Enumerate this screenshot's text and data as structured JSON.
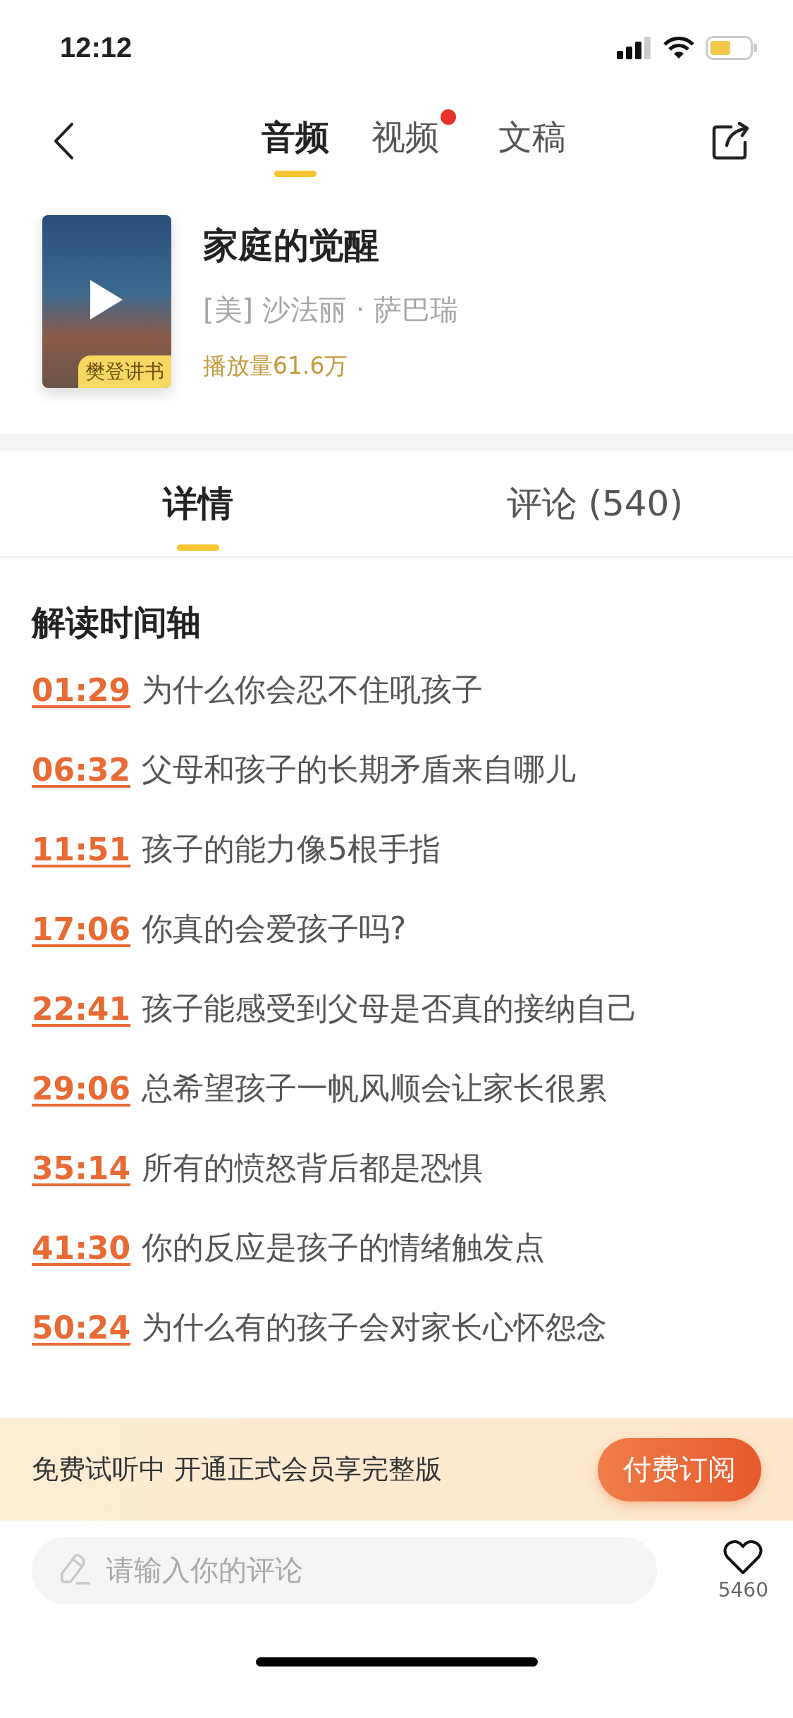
{
  "status_bar": {
    "time": "12:12"
  },
  "nav": {
    "tabs": [
      {
        "label": "音频",
        "selected": true,
        "dot": false
      },
      {
        "label": "视频",
        "selected": false,
        "dot": true
      },
      {
        "label": "文稿",
        "selected": false,
        "dot": false
      }
    ]
  },
  "book": {
    "badge": "樊登讲书",
    "title": "家庭的觉醒",
    "author": "[美] 沙法丽 · 萨巴瑞",
    "plays": "播放量61.6万"
  },
  "detail_tabs": [
    {
      "label": "详情",
      "selected": true
    },
    {
      "label": "评论 (540)",
      "selected": false
    }
  ],
  "timeline": {
    "title": "解读时间轴",
    "items": [
      {
        "time": "01:29",
        "title": "为什么你会忍不住吼孩子"
      },
      {
        "time": "06:32",
        "title": "父母和孩子的长期矛盾来自哪儿"
      },
      {
        "time": "11:51",
        "title": "孩子的能力像5根手指"
      },
      {
        "time": "17:06",
        "title": "你真的会爱孩子吗?"
      },
      {
        "time": "22:41",
        "title": "孩子能感受到父母是否真的接纳自己"
      },
      {
        "time": "29:06",
        "title": "总希望孩子一帆风顺会让家长很累"
      },
      {
        "time": "35:14",
        "title": "所有的愤怒背后都是恐惧"
      },
      {
        "time": "41:30",
        "title": "你的反应是孩子的情绪触发点"
      },
      {
        "time": "50:24",
        "title": "为什么有的孩子会对家长心怀怨念"
      }
    ]
  },
  "trial_banner": {
    "text": "免费试听中 开通正式会员享完整版",
    "button": "付费订阅"
  },
  "comment_bar": {
    "placeholder": "请输入你的评论",
    "likes": "5460"
  }
}
